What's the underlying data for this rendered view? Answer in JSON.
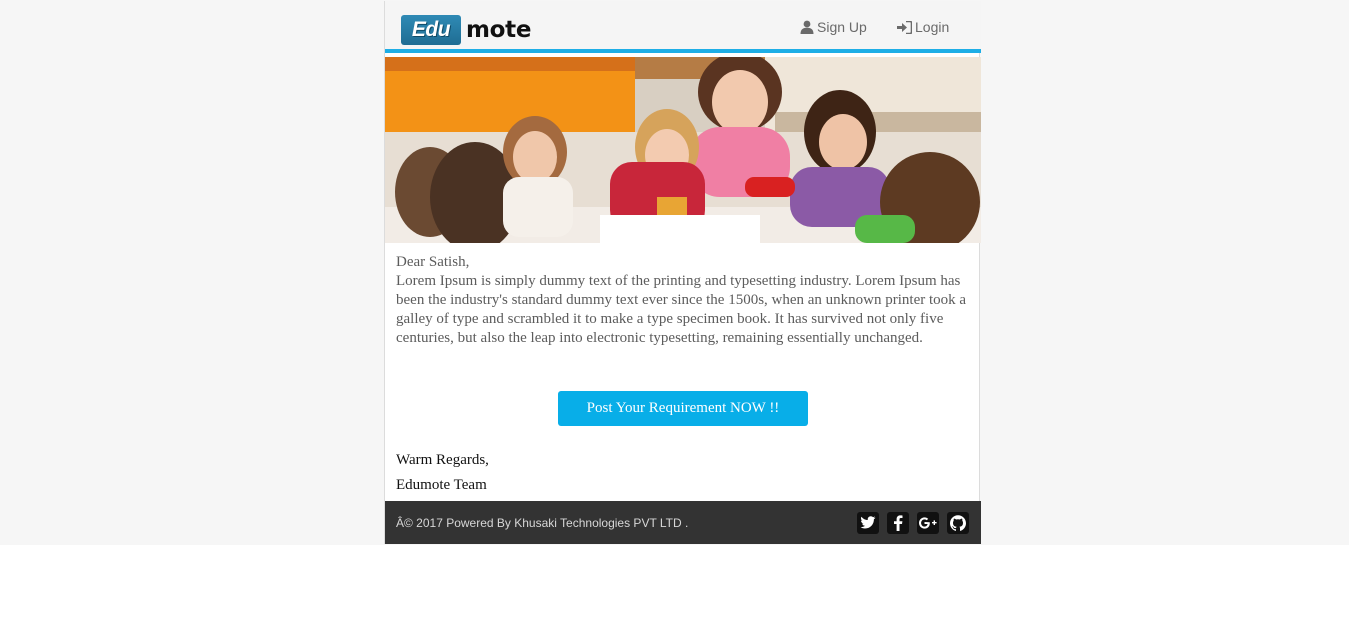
{
  "header": {
    "logo_box_text": "Edu",
    "logo_text": "mote",
    "nav": [
      {
        "label": "Sign Up",
        "icon": "user-icon"
      },
      {
        "label": "Login",
        "icon": "sign-in-icon"
      }
    ]
  },
  "hero": {
    "icon": "classroom-photo"
  },
  "body": {
    "greeting": "Dear Satish,",
    "paragraph": "Lorem Ipsum is simply dummy text of the printing and typesetting industry. Lorem Ipsum has been the industry's standard dummy text ever since the 1500s, when an unknown printer took a galley of type and scrambled it to make a type specimen book. It has survived not only five centuries, but also the leap into electronic typesetting, remaining essentially unchanged.",
    "cta_label": "Post Your Requirement NOW !!",
    "regards": "Warm Regards,",
    "team": "Edumote Team"
  },
  "footer": {
    "copyright": "Â© 2017 Powered By Khusaki Technologies PVT LTD .",
    "social": [
      "twitter-icon",
      "facebook-icon",
      "google-plus-icon",
      "github-icon"
    ]
  },
  "colors": {
    "accent": "#08aee8",
    "header_border": "#1eaee6",
    "footer_bg": "#333333",
    "logo_blue": "#2f8ab5"
  }
}
